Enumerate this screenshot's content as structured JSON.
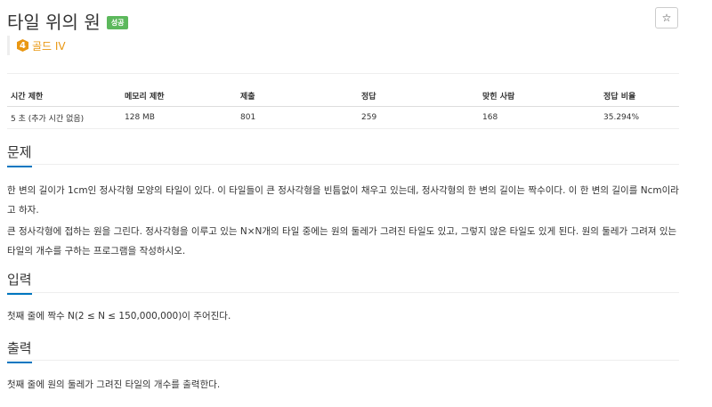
{
  "problem": {
    "title": "타일 위의 원",
    "result_badge": "성공",
    "star_label": "☆",
    "tier": {
      "level": "4",
      "label": "골드 IV",
      "color": "#e99712"
    }
  },
  "stats": {
    "headers": [
      "시간 제한",
      "메모리 제한",
      "제출",
      "정답",
      "맞힌 사람",
      "정답 비율"
    ],
    "row": [
      "5 초 (추가 시간 없음)",
      "128 MB",
      "801",
      "259",
      "168",
      "35.294%"
    ]
  },
  "sections": {
    "problem": {
      "heading": "문제",
      "paragraphs": [
        "한 변의 길이가 1cm인 정사각형 모양의 타일이 있다. 이 타일들이 큰 정사각형을 빈틈없이 채우고 있는데, 정사각형의 한 변의 길이는 짝수이다. 이 한 변의 길이를 Ncm이라고 하자.",
        "큰 정사각형에 접하는 원을 그린다. 정사각형을 이루고 있는 N×N개의 타일 중에는 원의 둘레가 그려진 타일도 있고, 그렇지 않은 타일도 있게 된다. 원의 둘레가 그려져 있는 타일의 개수를 구하는 프로그램을 작성하시오."
      ]
    },
    "input": {
      "heading": "입력",
      "text": "첫째 줄에 짝수 N(2 ≤ N ≤ 150,000,000)이 주어진다."
    },
    "output": {
      "heading": "출력",
      "text": "첫째 줄에 원의 둘레가 그려진 타일의 개수를 출력한다."
    }
  },
  "colors": {
    "accent": "#0076c0",
    "success": "#5cb85c",
    "gold": "#e99712"
  }
}
